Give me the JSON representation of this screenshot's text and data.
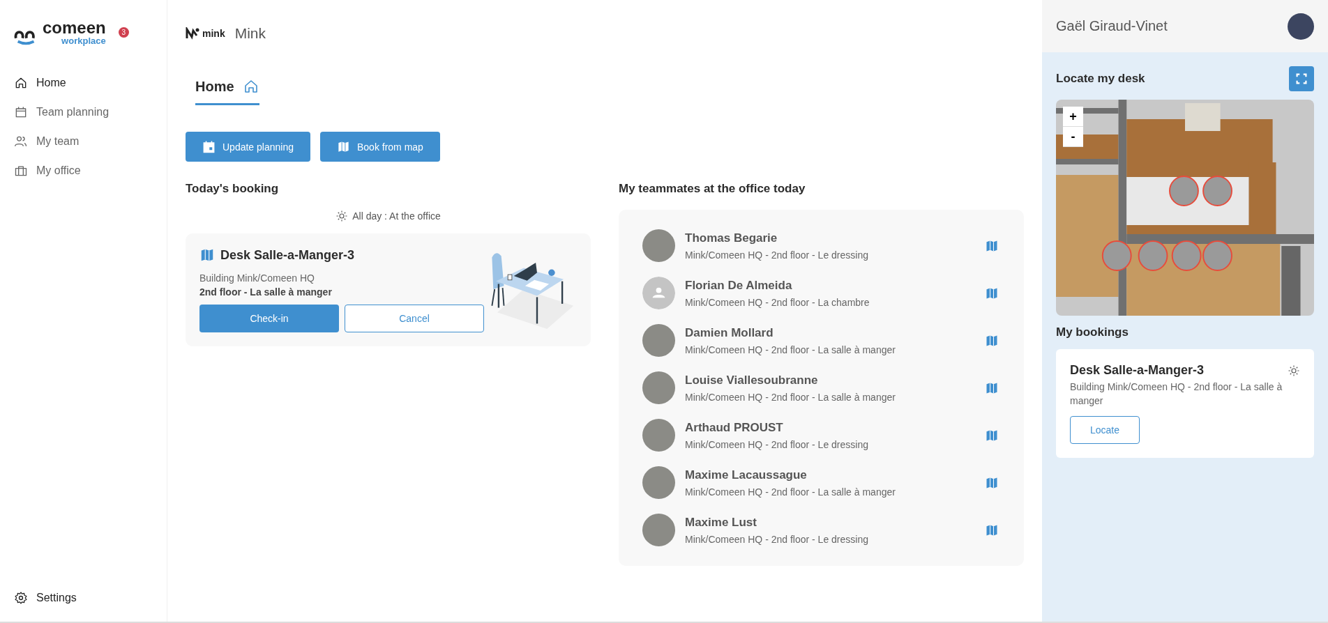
{
  "brand": {
    "logo_word": "comeen",
    "logo_sub": "workplace",
    "badge": "3"
  },
  "sidebar": {
    "items": [
      {
        "label": "Home",
        "selected": true
      },
      {
        "label": "Team planning",
        "selected": false
      },
      {
        "label": "My team",
        "selected": false
      },
      {
        "label": "My office",
        "selected": false
      }
    ],
    "footer": {
      "label": "Settings"
    }
  },
  "header": {
    "company_logo": "mink",
    "company": "Mink"
  },
  "tabs": [
    {
      "label": "Home",
      "selected": true
    }
  ],
  "actions": [
    {
      "label": "Update planning"
    },
    {
      "label": "Book from map"
    }
  ],
  "todays_booking": {
    "title": "Today's booking",
    "period": "All day : At the office",
    "desk": "Desk Salle-a-Manger-3",
    "building": "Building Mink/Comeen HQ",
    "floor": "2nd floor - La salle à manger",
    "buttons": [
      {
        "label": "Check-in",
        "kind": "primary"
      },
      {
        "label": "Cancel",
        "kind": "outline"
      }
    ]
  },
  "teammates": {
    "title": "My teammates at the office today",
    "people": [
      {
        "name": "Thomas Begarie",
        "location": "Mink/Comeen HQ - 2nd floor - Le dressing",
        "kind": "photo"
      },
      {
        "name": "Florian De Almeida",
        "location": "Mink/Comeen HQ - 2nd floor - La chambre",
        "kind": "placeholder"
      },
      {
        "name": "Damien Mollard",
        "location": "Mink/Comeen HQ - 2nd floor - La salle à manger",
        "kind": "photo"
      },
      {
        "name": "Louise Viallesoubranne",
        "location": "Mink/Comeen HQ - 2nd floor - La salle à manger",
        "kind": "photo"
      },
      {
        "name": "Arthaud PROUST",
        "location": "Mink/Comeen HQ - 2nd floor - Le dressing",
        "kind": "photo"
      },
      {
        "name": "Maxime Lacaussague",
        "location": "Mink/Comeen HQ - 2nd floor - La salle à manger",
        "kind": "photo"
      },
      {
        "name": "Maxime Lust",
        "location": "Mink/Comeen HQ - 2nd floor - Le dressing",
        "kind": "photo"
      }
    ]
  },
  "user": {
    "name": "Gaël Giraud-Vinet"
  },
  "locate": {
    "title": "Locate my desk",
    "zoom_in": "+",
    "zoom_out": "-"
  },
  "my_bookings": {
    "title": "My bookings",
    "items": [
      {
        "desk": "Desk Salle-a-Manger-3",
        "place": "Building Mink/Comeen HQ - 2nd floor - La salle à manger",
        "button": "Locate"
      }
    ]
  }
}
